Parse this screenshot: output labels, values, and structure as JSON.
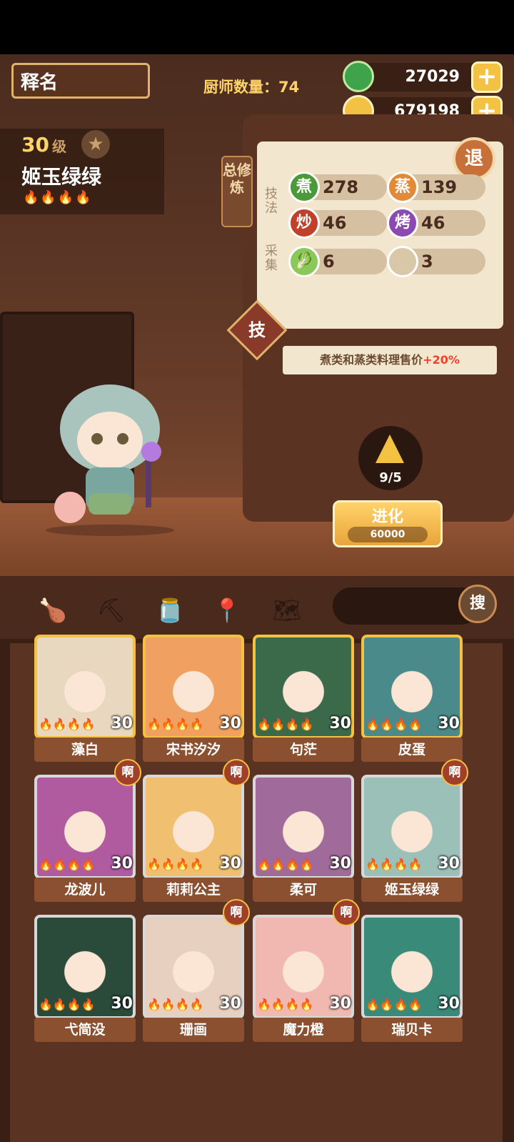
{
  "header": {
    "nickname": "释名",
    "chef_count": "厨师数量：74"
  },
  "currencies": [
    {
      "name": "jade",
      "value": "27029",
      "color": "#3ea34a"
    },
    {
      "name": "coin",
      "value": "679198",
      "color": "#f4c243"
    }
  ],
  "chef": {
    "level": "30",
    "level_unit": "级",
    "name": "姬玉绿绿",
    "flames": "🔥🔥🔥🔥"
  },
  "detail_panel": {
    "side_tab": "总修炼",
    "retreat_button": "退",
    "skill_label": "技法",
    "gather_label": "采集",
    "skills": [
      {
        "icon": "煮",
        "value": "278",
        "color": "#4a9a3a"
      },
      {
        "icon": "蒸",
        "value": "139",
        "color": "#e08a3a"
      },
      {
        "icon": "炒",
        "value": "46",
        "color": "#c0402a"
      },
      {
        "icon": "烤",
        "value": "46",
        "color": "#8a4ab0"
      }
    ],
    "gather": [
      {
        "icon": "cabbage-icon",
        "value": "6"
      },
      {
        "icon": "flour-icon",
        "value": "3"
      }
    ],
    "skill_button": "技",
    "bonus_text": "煮类和蒸类料理售价",
    "bonus_pct": "+20%",
    "evolve_count": "9/5",
    "evolve_label": "进化",
    "evolve_cost": "60000"
  },
  "toolbar": {
    "search_button": "搜"
  },
  "roster": [
    {
      "name": "藻白",
      "level": "30",
      "frame": "gold",
      "badge": ""
    },
    {
      "name": "宋书汐汐",
      "level": "30",
      "frame": "gold",
      "badge": ""
    },
    {
      "name": "句茫",
      "level": "30",
      "frame": "gold",
      "badge": ""
    },
    {
      "name": "皮蛋",
      "level": "30",
      "frame": "gold",
      "badge": ""
    },
    {
      "name": "龙波儿",
      "level": "30",
      "frame": "silver",
      "badge": "啊"
    },
    {
      "name": "莉莉公主",
      "level": "30",
      "frame": "silver",
      "badge": "啊"
    },
    {
      "name": "柔可",
      "level": "30",
      "frame": "silver",
      "badge": ""
    },
    {
      "name": "姬玉绿绿",
      "level": "30",
      "frame": "silver",
      "badge": "啊"
    },
    {
      "name": "弋简没",
      "level": "30",
      "frame": "silver",
      "badge": ""
    },
    {
      "name": "珊画",
      "level": "30",
      "frame": "silver",
      "badge": "啊"
    },
    {
      "name": "魔力橙",
      "level": "30",
      "frame": "silver",
      "badge": "啊"
    },
    {
      "name": "瑞贝卡",
      "level": "30",
      "frame": "silver",
      "badge": ""
    }
  ]
}
